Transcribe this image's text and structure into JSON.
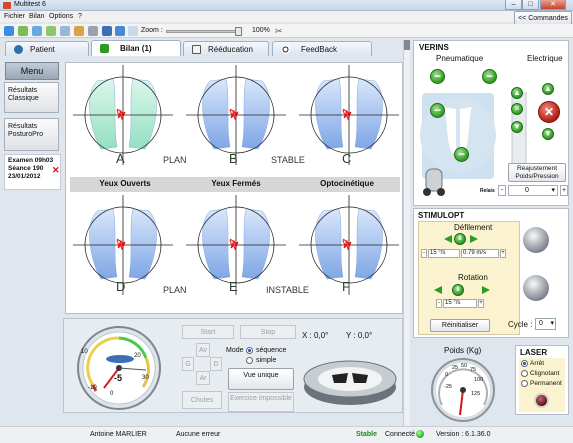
{
  "window": {
    "title": "Multitest 6",
    "min": "–",
    "max": "□",
    "close": "✕"
  },
  "menubar": {
    "items": [
      "Fichier",
      "Bilan",
      "Options",
      "?"
    ],
    "commands_button": "<< Commandes"
  },
  "toolbar": {
    "zoom_label": "Zoom :",
    "zoom_value": "100%",
    "zoom_fraction": 1.0
  },
  "tabs": [
    {
      "label": "Patient",
      "icon": "person-icon"
    },
    {
      "label": "Bilan (1)",
      "icon": "feet-icon",
      "active": true
    },
    {
      "label": "Rééducation",
      "icon": "document-icon"
    },
    {
      "label": "FeedBack",
      "icon": "soccer-ball-icon"
    }
  ],
  "sidebar": {
    "menu_title": "Menu",
    "items": [
      {
        "label": "Résultats Classique"
      },
      {
        "label": "Résultats PosturoPro"
      }
    ],
    "exam": {
      "line1": "Examen 09h03",
      "line2": "Séance 190",
      "line3": "23/01/2012",
      "close": "✕"
    }
  },
  "plots": {
    "top": [
      {
        "letter": "A",
        "style": "green"
      },
      {
        "letter": "B",
        "style": "blue"
      },
      {
        "letter": "C",
        "style": "blue"
      }
    ],
    "bottom": [
      {
        "letter": "D",
        "style": "blue"
      },
      {
        "letter": "E",
        "style": "blue"
      },
      {
        "letter": "F",
        "style": "blue"
      }
    ],
    "labels": {
      "plan_top": "PLAN",
      "stable": "STABLE",
      "plan_bottom": "PLAN",
      "instable": "INSTABLE"
    },
    "columns": [
      "Yeux Ouverts",
      "Yeux Fermés",
      "Optocinétique"
    ]
  },
  "controls": {
    "start": "Start",
    "stop": "Stop",
    "av": "Av",
    "ar": "Ar",
    "g": "G",
    "d": "D",
    "chutes": "Chutes",
    "mode_label": "Mode",
    "mode_options": [
      "séquence",
      "simple"
    ],
    "mode_selected": "séquence",
    "vue_unique": "Vue unique",
    "exercice_impossible": "Exercice impossible",
    "x_readout": "X : 0,0°",
    "y_readout": "Y : 0,0°",
    "gauge_value": "-5",
    "gauge_ticks": [
      "-10",
      "0",
      "10",
      "20",
      "30"
    ]
  },
  "verins": {
    "title": "VERINS",
    "pneumatique": "Pneumatique",
    "electrique": "Electrique",
    "reajustement": "Réajustement Poids/Pression",
    "relais": "Relais",
    "select_value": "0"
  },
  "stimulopt": {
    "title": "STIMULOPT",
    "defilement": "Défilement",
    "def_speed": "15 °/s",
    "def_ms": "0.79 m/s",
    "rotation": "Rotation",
    "rot_speed": "15 °/s",
    "reinitialiser": "Réinitialiser",
    "cycle_label": "Cycle :",
    "cycle_value": "0"
  },
  "poids": {
    "title": "Poids (Kg)",
    "ticks": [
      "-25",
      "0",
      "25",
      "50",
      "75",
      "100",
      "125"
    ],
    "needle_fraction": 0.55
  },
  "laser": {
    "title": "LASER",
    "options": [
      "Arrêt",
      "Clignotant",
      "Permanent"
    ],
    "selected": "Arrêt"
  },
  "status": {
    "user": "Antoine MARLIER",
    "error": "Aucune erreur",
    "state": "Stable",
    "connected": "Connecté",
    "version": "Version : 6.1.36.0"
  },
  "colors": {
    "green": "#2d9b1f",
    "accent_blue": "#2f6fb0",
    "stable": "#1d8b18",
    "status_dot": "#1cb51c"
  }
}
